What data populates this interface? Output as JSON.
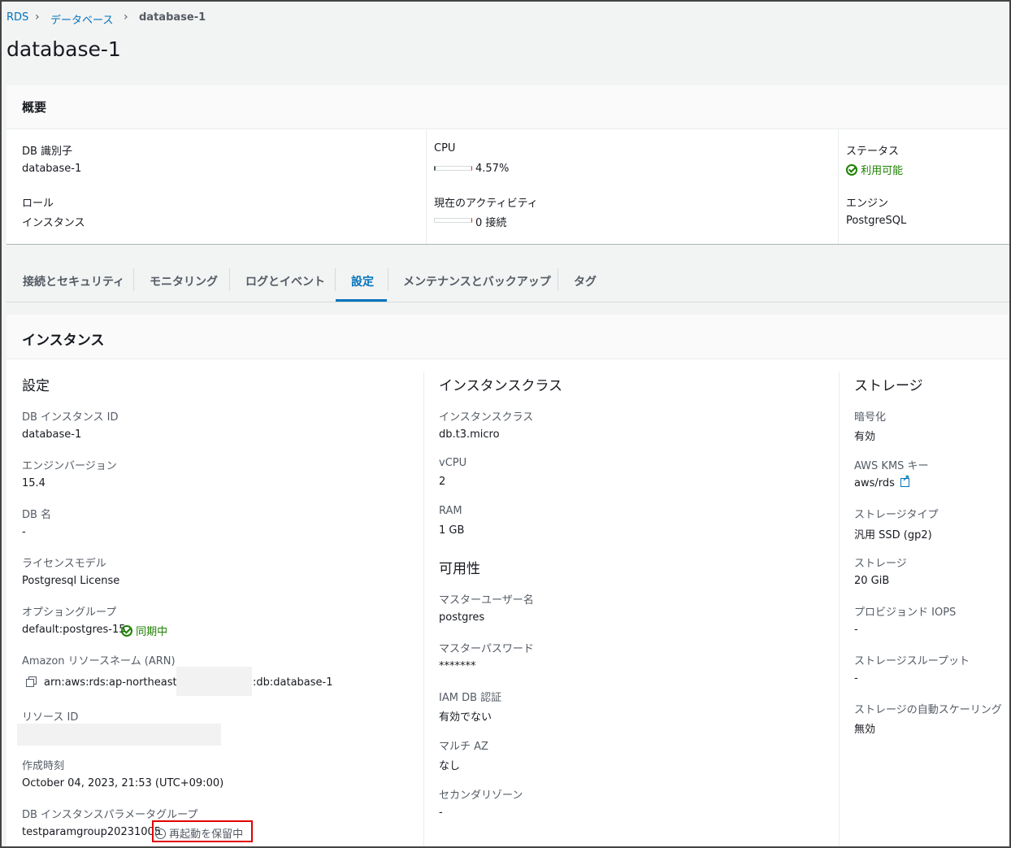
{
  "breadcrumb": {
    "rds": "RDS",
    "databases": "データベース",
    "current": "database-1"
  },
  "page_title": "database-1",
  "summary": {
    "title": "概要",
    "db_id_label": "DB 識別子",
    "db_id_value": "database-1",
    "role_label": "ロール",
    "role_value": "インスタンス",
    "cpu_label": "CPU",
    "cpu_value": "4.57%",
    "cpu_level": 0.0457,
    "activity_label": "現在のアクティビティ",
    "activity_value": "0 接続",
    "status_label": "ステータス",
    "status_value": "利用可能",
    "engine_label": "エンジン",
    "engine_value": "PostgreSQL"
  },
  "tabs": [
    {
      "label": "接続とセキュリティ"
    },
    {
      "label": "モニタリング"
    },
    {
      "label": "ログとイベント"
    },
    {
      "label": "設定",
      "active": true
    },
    {
      "label": "メンテナンスとバックアップ"
    },
    {
      "label": "タグ"
    }
  ],
  "instance": {
    "title": "インスタンス",
    "config": {
      "heading": "設定",
      "instance_id_label": "DB インスタンス ID",
      "instance_id_value": "database-1",
      "engine_version_label": "エンジンバージョン",
      "engine_version_value": "15.4",
      "db_name_label": "DB 名",
      "db_name_value": "-",
      "license_label": "ライセンスモデル",
      "license_value": "Postgresql License",
      "option_group_label": "オプショングループ",
      "option_group_value": "default:postgres-15",
      "option_group_status": "同期中",
      "arn_label": "Amazon リソースネーム (ARN)",
      "arn_prefix": "arn:aws:rds:ap-northeast-1:",
      "arn_suffix": ":db:database-1",
      "resource_id_label": "リソース ID",
      "created_label": "作成時刻",
      "created_value": "October 04, 2023, 21:53 (UTC+09:00)",
      "param_group_label": "DB インスタンスパラメータグループ",
      "param_group_value": "testparamgroup20231005",
      "param_group_status": "再起動を保留中"
    },
    "class": {
      "heading": "インスタンスクラス",
      "class_label": "インスタンスクラス",
      "class_value": "db.t3.micro",
      "vcpu_label": "vCPU",
      "vcpu_value": "2",
      "ram_label": "RAM",
      "ram_value": "1 GB"
    },
    "availability": {
      "heading": "可用性",
      "master_user_label": "マスターユーザー名",
      "master_user_value": "postgres",
      "master_pw_label": "マスターパスワード",
      "master_pw_value": "*******",
      "iam_label": "IAM DB 認証",
      "iam_value": "有効でない",
      "multi_az_label": "マルチ AZ",
      "multi_az_value": "なし",
      "secondary_zone_label": "セカンダリゾーン",
      "secondary_zone_value": "-"
    },
    "storage": {
      "heading": "ストレージ",
      "encryption_label": "暗号化",
      "encryption_value": "有効",
      "kms_label": "AWS KMS キー",
      "kms_value": "aws/rds",
      "type_label": "ストレージタイプ",
      "type_value": "汎用 SSD (gp2)",
      "storage_label": "ストレージ",
      "storage_value": "20 GiB",
      "iops_label": "プロビジョンド IOPS",
      "iops_value": "-",
      "throughput_label": "ストレージスループット",
      "throughput_value": "-",
      "autoscaling_label": "ストレージの自動スケーリング",
      "autoscaling_value": "無効"
    }
  },
  "colors": {
    "link": "#0073bb",
    "success": "#1d8102",
    "highlight_box": "#e00000"
  }
}
